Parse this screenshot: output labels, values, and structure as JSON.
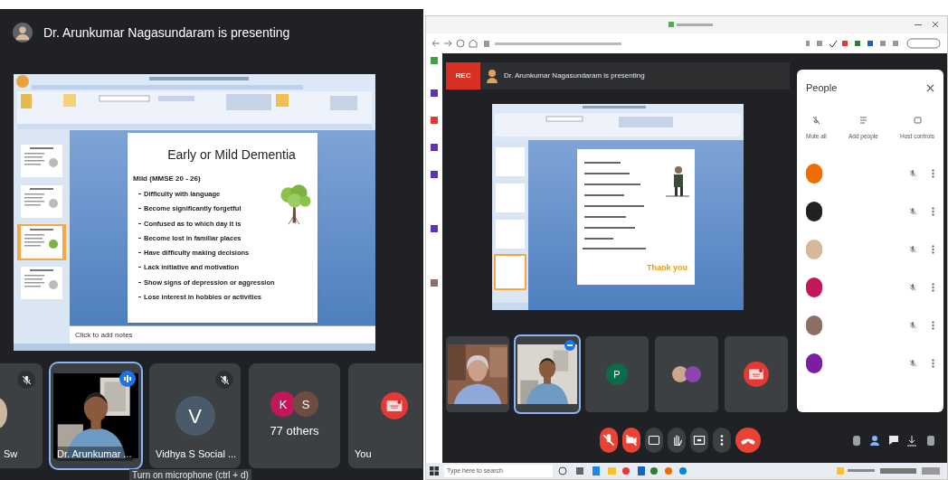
{
  "left": {
    "presenter_banner": "Dr. Arunkumar Nagasundaram is presenting",
    "slide": {
      "title": "Early or Mild Dementia",
      "bullet": "Mild (MMSE 20 - 26)",
      "sub_bullets": [
        "Difficulty with language",
        "Become significantly forgetful",
        "Confused as to which day it is",
        "Become lost in familiar places",
        "Have difficulty making decisions",
        "Lack initiative and motivation",
        "Show signs of depression or aggression",
        "Lose interest in hobbies or activities"
      ]
    },
    "notes_placeholder": "Click to add notes",
    "thumbnails": [
      {
        "selected": false
      },
      {
        "selected": false
      },
      {
        "selected": true
      },
      {
        "selected": false
      }
    ],
    "tiles": [
      {
        "kind": "partial",
        "name": "Sw",
        "muted": true,
        "speaking": false
      },
      {
        "kind": "video",
        "name": "Dr. Arunkumar ...",
        "muted": false,
        "speaking": true
      },
      {
        "kind": "avatar",
        "initial": "V",
        "name": "Vidhya S Social ...",
        "muted": true,
        "speaking": false
      },
      {
        "kind": "group",
        "initials": [
          {
            "letter": "K",
            "color": "#c2185b"
          },
          {
            "letter": "S",
            "color": "#6d4c41"
          }
        ],
        "name": "77 others",
        "muted": false,
        "speaking": false
      },
      {
        "kind": "self",
        "name": "You",
        "muted": false,
        "speaking": false
      }
    ],
    "tooltip": "Turn on microphone (ctrl + d)"
  },
  "right": {
    "rec_badge": "REC",
    "presenter_banner": "Dr. Arunkumar Nagasundaram is presenting",
    "slide_closing": "Thank you",
    "people_panel": {
      "title": "People",
      "actions": [
        "Mute all",
        "Add people",
        "Host controls"
      ],
      "participants": [
        {
          "color": "#ef6c00"
        },
        {
          "color": "#212121"
        },
        {
          "color": "#d7b899"
        },
        {
          "color": "#c2185b"
        },
        {
          "color": "#8d6e63"
        },
        {
          "color": "#7b1fa2"
        }
      ]
    },
    "tiles": [
      {
        "kind": "video",
        "speaking": false
      },
      {
        "kind": "video",
        "speaking": true
      },
      {
        "kind": "avatar",
        "initial": "P",
        "speaking": false
      },
      {
        "kind": "group",
        "speaking": false
      },
      {
        "kind": "self",
        "speaking": false
      }
    ],
    "controls": [
      {
        "kind": "mic",
        "off": true
      },
      {
        "kind": "camera",
        "off": true
      },
      {
        "kind": "captions",
        "off": false
      },
      {
        "kind": "hand",
        "off": false
      },
      {
        "kind": "present",
        "off": false
      },
      {
        "kind": "more",
        "off": false
      },
      {
        "kind": "leave"
      }
    ],
    "taskbar_search": "Type here to search"
  }
}
